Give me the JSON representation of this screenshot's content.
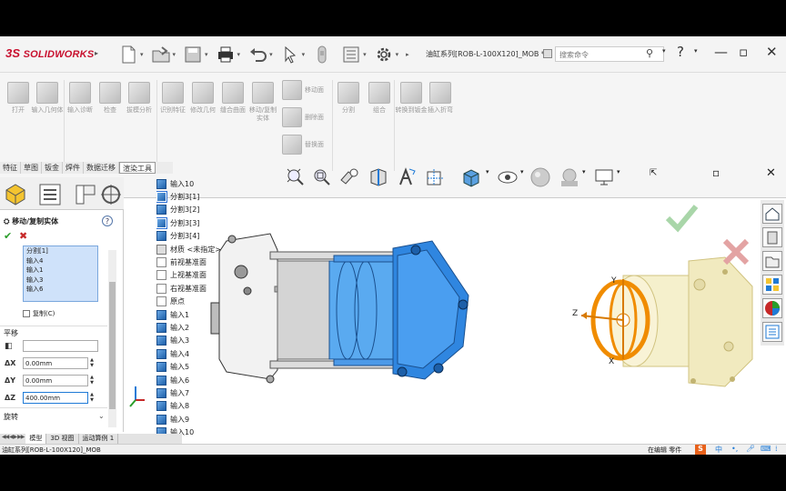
{
  "app": {
    "logo": "SOLIDWORKS",
    "logo_prefix": "3S",
    "doc_title": "油缸系列[ROB-L-100X120]_MOB *",
    "search_placeholder": "搜索命令",
    "help_symbol": "?",
    "window_controls": [
      "—",
      "▫",
      "✕"
    ]
  },
  "ribbon": {
    "buttons": [
      {
        "label": "打开",
        "icon": "open-part-icon"
      },
      {
        "label": "输入几何体",
        "icon": "import-geometry-icon"
      },
      {
        "label": "输入诊断",
        "icon": "import-diagnostics-icon"
      },
      {
        "label": "检查",
        "icon": "check-icon"
      },
      {
        "label": "拔模分析",
        "icon": "draft-analysis-icon"
      },
      {
        "label": "识别特征",
        "icon": "recognize-features-icon"
      },
      {
        "label": "修改几何",
        "icon": "repair-geometry-icon"
      },
      {
        "label": "缝合曲面",
        "icon": "knit-surface-icon"
      },
      {
        "label": "移动/复制实体",
        "icon": "move-copy-body-icon"
      },
      {
        "label": "分割",
        "icon": "split-icon"
      },
      {
        "label": "组合",
        "icon": "combine-icon"
      },
      {
        "label": "转换到钣金",
        "icon": "convert-to-sheetmetal-icon"
      },
      {
        "label": "插入折弯",
        "icon": "insert-bends-icon"
      }
    ],
    "small_buttons": [
      {
        "label": "移动面",
        "icon": "move-face-icon"
      },
      {
        "label": "删除面",
        "icon": "delete-face-icon"
      },
      {
        "label": "替换面",
        "icon": "replace-face-icon"
      }
    ]
  },
  "tabs": [
    "特征",
    "草图",
    "钣金",
    "焊件",
    "数据迁移",
    "渲染工具"
  ],
  "active_tab": "数据迁移",
  "property_manager": {
    "title": "移动/复制实体",
    "selected_bodies": [
      "分割[1]",
      "输入4",
      "输入1",
      "输入3",
      "输入6"
    ],
    "copy_label": "复制(C)",
    "translate_section": "平移",
    "dx_label": "ΔX",
    "dx_value": "0.00mm",
    "dy_label": "ΔY",
    "dy_value": "0.00mm",
    "dz_label": "ΔZ",
    "dz_value": "400.00mm",
    "rotate_section": "旋转"
  },
  "tree": [
    {
      "label": "输入10",
      "type": "body"
    },
    {
      "label": "分割3[1]",
      "type": "body",
      "selected": true
    },
    {
      "label": "分割3[2]",
      "type": "body"
    },
    {
      "label": "分割3[3]",
      "type": "body",
      "selected": true
    },
    {
      "label": "分割3[4]",
      "type": "body"
    },
    {
      "label": "材质 <未指定>",
      "type": "material"
    },
    {
      "label": "前视基准面",
      "type": "plane"
    },
    {
      "label": "上视基准面",
      "type": "plane"
    },
    {
      "label": "右视基准面",
      "type": "plane"
    },
    {
      "label": "原点",
      "type": "origin"
    },
    {
      "label": "输入1",
      "type": "body"
    },
    {
      "label": "输入2",
      "type": "body"
    },
    {
      "label": "输入3",
      "type": "body"
    },
    {
      "label": "输入4",
      "type": "body"
    },
    {
      "label": "输入5",
      "type": "body"
    },
    {
      "label": "输入6",
      "type": "body"
    },
    {
      "label": "输入7",
      "type": "body"
    },
    {
      "label": "输入8",
      "type": "body"
    },
    {
      "label": "输入9",
      "type": "body"
    },
    {
      "label": "输入10",
      "type": "body"
    }
  ],
  "triad": {
    "x": "X",
    "y": "Y",
    "z": "Z"
  },
  "bottom_tabs": [
    "模型",
    "3D 视图",
    "运动算例 1"
  ],
  "active_bottom_tab": "模型",
  "status": {
    "filename": "油缸系列[ROB-L-100X120]_MOB",
    "mode": "在编辑 零件",
    "ime_lang": "中"
  },
  "colors": {
    "accent_blue": "#1f7ad6",
    "ok_green": "#2a9d2a",
    "cancel_red": "#c62828",
    "brand_red": "#c8102e",
    "ghost_yellow": "#f2eab0",
    "triad_orange": "#f08c00"
  }
}
